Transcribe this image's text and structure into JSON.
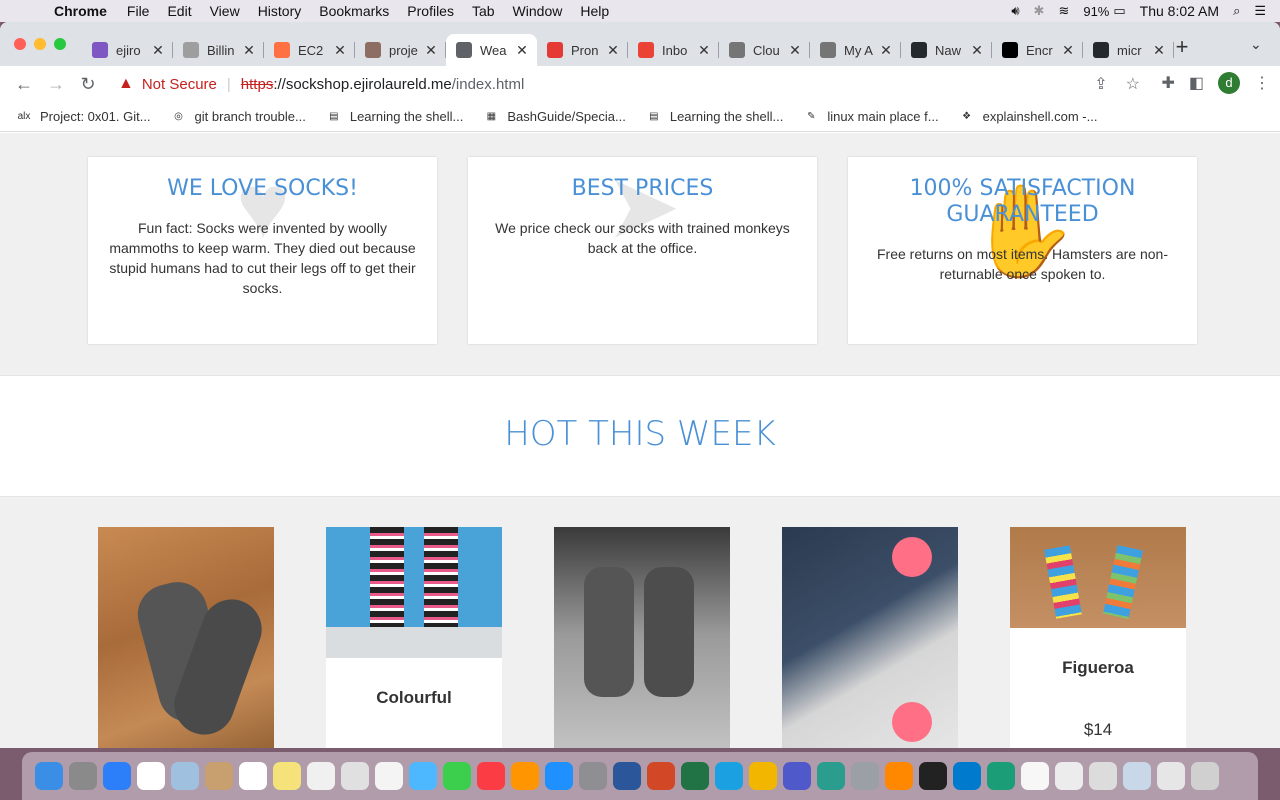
{
  "menubar": {
    "app": "Chrome",
    "items": [
      "File",
      "Edit",
      "View",
      "History",
      "Bookmarks",
      "Profiles",
      "Tab",
      "Window",
      "Help"
    ],
    "battery": "91%",
    "clock": "Thu 8:02 AM"
  },
  "tabs": [
    {
      "label": "ejiro",
      "icon": "ejiro-favicon",
      "color": "#7e57c2"
    },
    {
      "label": "Billin",
      "icon": "billing-favicon",
      "color": "#9e9e9e"
    },
    {
      "label": "EC2",
      "icon": "ec2-favicon",
      "color": "#ff7043"
    },
    {
      "label": "proje",
      "icon": "project-avatar-favicon",
      "color": "#8d6e63"
    },
    {
      "label": "Wea",
      "icon": "sock-favicon",
      "color": "#5f6368"
    },
    {
      "label": "Pron",
      "icon": "pronunciation-favicon",
      "color": "#e53935"
    },
    {
      "label": "Inbo",
      "icon": "gmail-favicon",
      "color": "#ea4335"
    },
    {
      "label": "Clou",
      "icon": "cloud-favicon",
      "color": "#757575"
    },
    {
      "label": "My A",
      "icon": "my-account-favicon",
      "color": "#757575"
    },
    {
      "label": "Naw",
      "icon": "github-favicon",
      "color": "#24292e"
    },
    {
      "label": "Encr",
      "icon": "medium-favicon",
      "color": "#000000"
    },
    {
      "label": "micr",
      "icon": "github-favicon",
      "color": "#24292e"
    }
  ],
  "active_tab_index": 4,
  "address": {
    "security_label": "Not Secure",
    "scheme": "https",
    "host": "://sockshop.ejirolaureld.me",
    "path": "/index.html"
  },
  "profile_initial": "d",
  "bookmarks": [
    {
      "label": "Project: 0x01. Git...",
      "icon": "alx-icon",
      "glyph": "alx"
    },
    {
      "label": "git branch trouble...",
      "icon": "gitbranch-icon",
      "glyph": "◎"
    },
    {
      "label": "Learning the shell...",
      "icon": "learning-shell-icon",
      "glyph": "▤"
    },
    {
      "label": "BashGuide/Specia...",
      "icon": "bashguide-icon",
      "glyph": "▦"
    },
    {
      "label": "Learning the shell...",
      "icon": "learning-shell-icon",
      "glyph": "▤"
    },
    {
      "label": "linux main place f...",
      "icon": "linux-icon",
      "glyph": "✎"
    },
    {
      "label": "explainshell.com -...",
      "icon": "explainshell-icon",
      "glyph": "❖"
    }
  ],
  "features": [
    {
      "title": "WE LOVE SOCKS!",
      "text": "Fun fact: Socks were invented by woolly mammoths to keep warm. They died out because stupid humans had to cut their legs off to get their socks.",
      "bg_icon": "heart-icon",
      "glyph": "♥"
    },
    {
      "title": "BEST PRICES",
      "text": "We price check our socks with trained monkeys back at the office.",
      "bg_icon": "tag-icon",
      "glyph": "➤"
    },
    {
      "title": "100% SATISFACTION GUARANTEED",
      "text": "Free returns on most items. Hamsters are non-returnable once spoken to.",
      "bg_icon": "thumbs-up-icon",
      "glyph": "✋"
    }
  ],
  "hot_title": "HOT THIS WEEK",
  "products": [
    {
      "name": "",
      "price": ""
    },
    {
      "name": "Colourful",
      "price": ""
    },
    {
      "name": "",
      "price": ""
    },
    {
      "name": "",
      "price": ""
    },
    {
      "name": "Figueroa",
      "price": "$14"
    }
  ],
  "dock_apps": [
    "finder-icon",
    "launchpad-icon",
    "safari-icon",
    "chrome-icon",
    "preview-icon",
    "contacts-icon",
    "calendar-icon",
    "notes-icon",
    "photos-icon",
    "photos-app-icon",
    "reminders-icon",
    "messages-icon",
    "facetime-icon",
    "music-icon",
    "books-icon",
    "appstore-icon",
    "settings-icon",
    "word-icon",
    "powerpoint-icon",
    "excel-icon",
    "c-icon",
    "o-icon",
    "teams-icon",
    "network-icon",
    "utility-icon",
    "vlc-icon",
    "terminal-icon",
    "vscode-icon",
    "vscode-insiders-icon",
    "textedit-icon",
    "doc-icon",
    "screenshot-icon",
    "folder-icon",
    "window-icon",
    "trash-icon"
  ]
}
